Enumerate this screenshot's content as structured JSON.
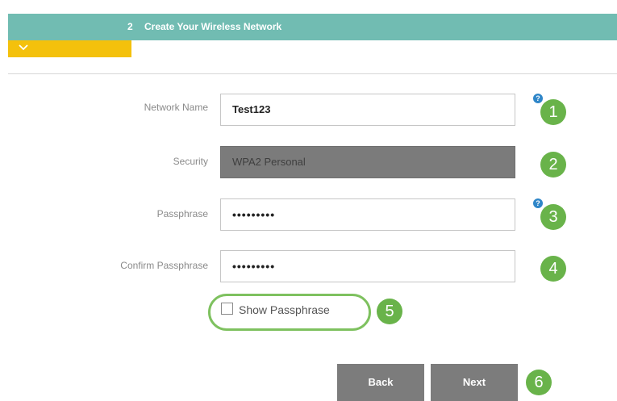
{
  "header": {
    "step_number": "2",
    "title": "Create Your Wireless Network"
  },
  "form": {
    "network_name": {
      "label": "Network Name",
      "value": "Test123"
    },
    "security": {
      "label": "Security",
      "value": "WPA2 Personal"
    },
    "passphrase": {
      "label": "Passphrase",
      "value": "•••••••••"
    },
    "confirm_passphrase": {
      "label": "Confirm Passphrase",
      "value": "•••••••••"
    },
    "show_passphrase": {
      "label": "Show Passphrase",
      "checked": false
    }
  },
  "help_icon_glyph": "?",
  "markers": [
    "1",
    "2",
    "3",
    "4",
    "5",
    "6"
  ],
  "buttons": {
    "back": "Back",
    "next": "Next"
  },
  "colors": {
    "header": "#71bcb2",
    "collapse_tab": "#f4c10c",
    "marker": "#69b34a",
    "button": "#7c7c7c",
    "help": "#2f86c8"
  },
  "icons": {
    "collapse": "chevron-down-icon",
    "help": "help-icon",
    "checkbox": "checkbox-icon"
  }
}
